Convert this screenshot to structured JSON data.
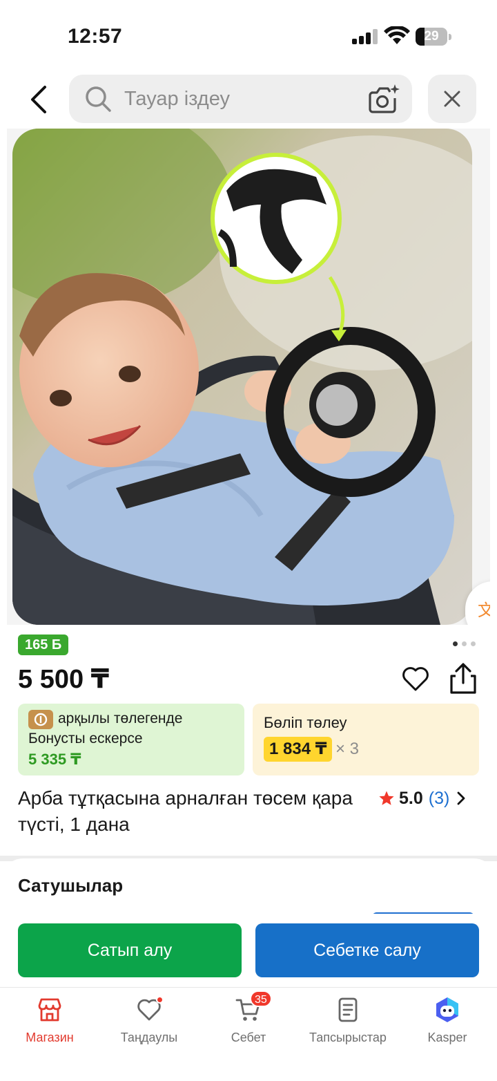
{
  "status_bar": {
    "time": "12:57",
    "battery_level": "29",
    "icons": [
      "signal-icon",
      "wifi-icon",
      "battery-icon"
    ]
  },
  "header": {
    "search_placeholder": "Тауар іздеу",
    "icons": [
      "back-arrow-icon",
      "search-icon",
      "camera-search-icon",
      "close-icon"
    ]
  },
  "gallery": {
    "total_images": 3,
    "current_index": 1,
    "icons": [
      "translate-icon",
      "footprint-icon"
    ]
  },
  "product": {
    "bonus_badge": "165 Б",
    "price": "5 500 ₸",
    "title": "Арба тұтқасына арналған төсем қара түсті, 1 дана",
    "rating_value": "5.0",
    "rating_count": "(3)",
    "bonus_card": {
      "line1": "арқылы төлегенде",
      "line2": "Бонусты ескерсе",
      "amount": "5 335 ₸"
    },
    "installment": {
      "title": "Бөліп төлеу",
      "amount": "1 834 ₸",
      "times": "× 3"
    }
  },
  "sellers": {
    "title": "Сатушылар"
  },
  "actions": {
    "buy_label": "Сатып алу",
    "cart_label": "Себетке салу"
  },
  "bottom_nav": {
    "items": [
      {
        "label": "Магазин",
        "icon": "shop-icon",
        "active": true
      },
      {
        "label": "Таңдаулы",
        "icon": "heart-icon",
        "dot": true
      },
      {
        "label": "Себет",
        "icon": "cart-icon",
        "badge": "35"
      },
      {
        "label": "Тапсырыстар",
        "icon": "orders-icon"
      },
      {
        "label": "Kasper",
        "icon": "kasper-icon"
      }
    ]
  },
  "colors": {
    "bonus_green": "#3aa82e",
    "buy_green": "#0ca44a",
    "cart_blue": "#1770c8",
    "active_red": "#e23a2e",
    "install_yellow": "#ffd52e"
  }
}
